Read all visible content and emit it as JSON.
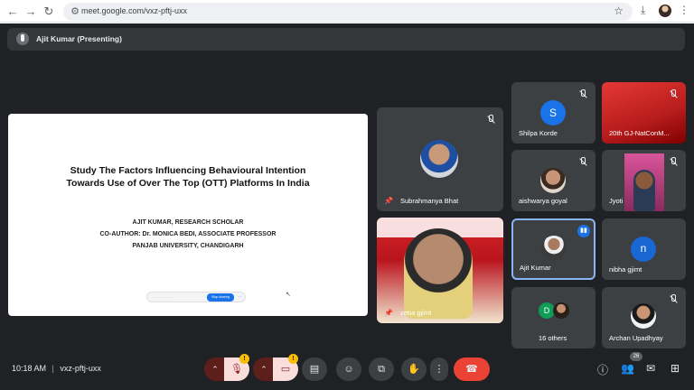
{
  "browser": {
    "url": "meet.google.com/vxz-pftj-uxx"
  },
  "presenting": {
    "label": "Ajit Kumar (Presenting)"
  },
  "slide": {
    "title_line1": "Study The Factors Influencing Behavioural Intention",
    "title_line2": "Towards Use of Over The Top (OTT) Platforms In India",
    "author": "AJIT KUMAR, RESEARCH SCHOLAR",
    "coauthor": "CO-AUTHOR: Dr. MONICA BEDI, ASSOCIATE PROFESSOR",
    "university": "PANJAB UNIVERSITY, CHANDIGARH",
    "share_button": "Stop sharing"
  },
  "tiles": {
    "subrahmanya": "Subrahmanya Bhat",
    "zeba": "zeba gjimt",
    "shilpa": {
      "name": "Shilpa Korde",
      "initial": "S"
    },
    "gj": "20th GJ-NatConM...",
    "aishwarya": "aishwarya goyal",
    "jyoti": "Jyoti",
    "ajit": "Ajit Kumar",
    "nibha": {
      "name": "nibha gjimt",
      "initial": "n"
    },
    "others": {
      "label": "16 others",
      "initial": "D"
    },
    "archan": "Archan Upadhyay"
  },
  "bottom": {
    "time": "10:18 AM",
    "meeting_code": "vxz-pftj-uxx",
    "people_count": "26",
    "mic_badge": "!",
    "cam_badge": "!"
  },
  "colors": {
    "meet_bg": "#202124",
    "tile_bg": "#3c4043",
    "end_call": "#ea4335",
    "active_speaker": "#8ab4f8",
    "shilpa_avatar": "#1a73e8",
    "nibha_avatar": "#1967d2",
    "others_avatar": "#0f9d58"
  }
}
